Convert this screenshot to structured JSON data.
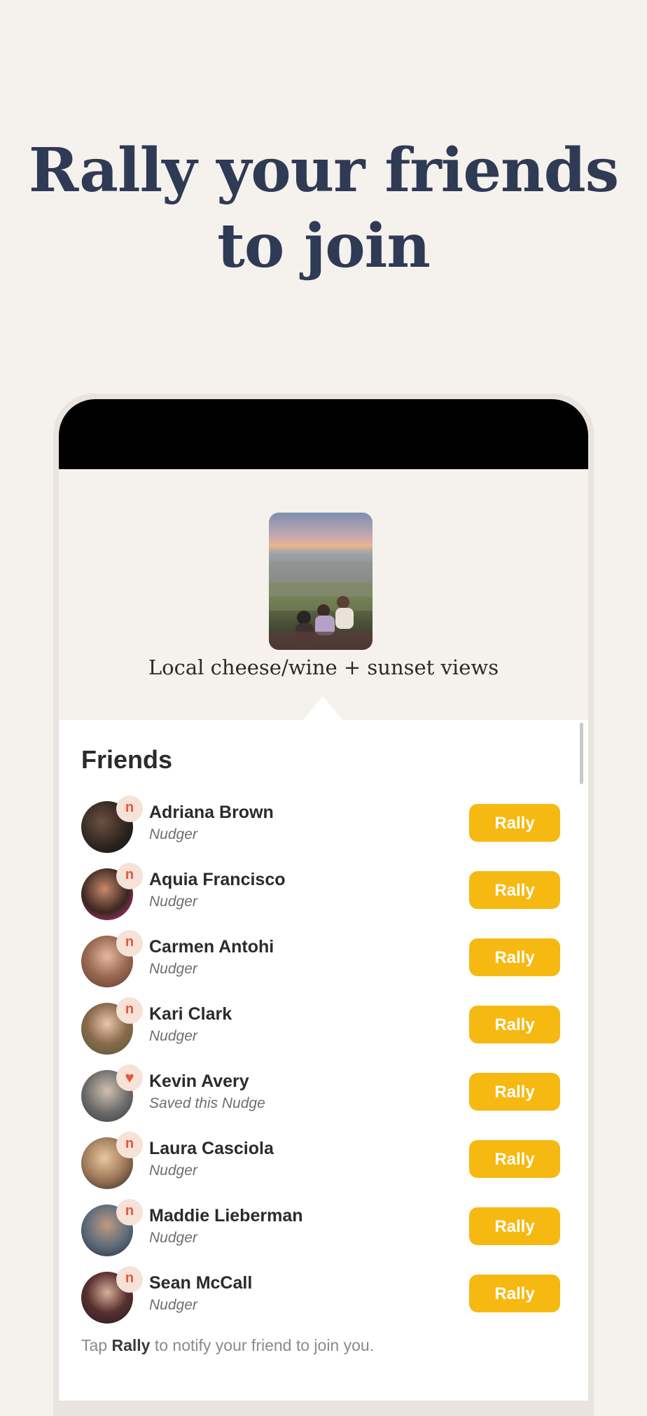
{
  "headline": {
    "line1": "Rally your friends",
    "line2": "to join"
  },
  "event": {
    "title": "Local cheese/wine + sunset views"
  },
  "friends_section": {
    "title": "Friends",
    "rally_label": "Rally",
    "items": [
      {
        "name": "Adriana Brown",
        "status": "Nudger",
        "badge": "n",
        "badge_icon": "nudge-icon"
      },
      {
        "name": "Aquia Francisco",
        "status": "Nudger",
        "badge": "n",
        "badge_icon": "nudge-icon"
      },
      {
        "name": "Carmen Antohi",
        "status": "Nudger",
        "badge": "n",
        "badge_icon": "nudge-icon"
      },
      {
        "name": "Kari Clark",
        "status": "Nudger",
        "badge": "n",
        "badge_icon": "nudge-icon"
      },
      {
        "name": "Kevin Avery",
        "status": "Saved this Nudge",
        "badge": "♥",
        "badge_icon": "heart-icon"
      },
      {
        "name": "Laura Casciola",
        "status": "Nudger",
        "badge": "n",
        "badge_icon": "nudge-icon"
      },
      {
        "name": "Maddie Lieberman",
        "status": "Nudger",
        "badge": "n",
        "badge_icon": "nudge-icon"
      },
      {
        "name": "Sean McCall",
        "status": "Nudger",
        "badge": "n",
        "badge_icon": "nudge-icon"
      }
    ]
  },
  "footer": {
    "prefix": "Tap",
    "bold": "Rally",
    "suffix": "to notify your friend to join you."
  },
  "colors": {
    "background": "#f5f1ed",
    "headline": "#2f3a55",
    "rally_button": "#f6b911",
    "badge_bg": "#f6e2d7",
    "badge_fg": "#e8553a"
  }
}
